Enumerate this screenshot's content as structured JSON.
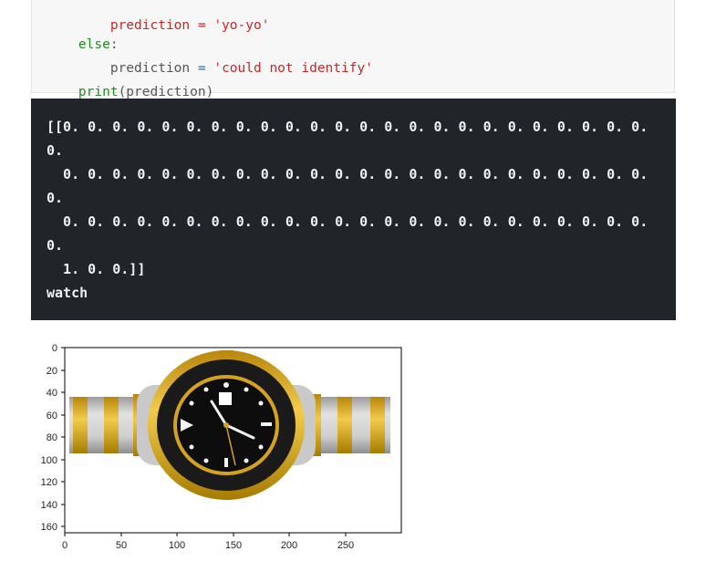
{
  "code": {
    "line1_partial": "    prediction = 'yo-yo'",
    "else_kw": "else",
    "else_colon": ":",
    "pred_indent": "    prediction ",
    "pred_eq": "=",
    "pred_str": "'could not identify'",
    "print_fn": "print",
    "print_args": "(prediction)"
  },
  "output": {
    "lines": [
      "[[0. 0. 0. 0. 0. 0. 0. 0. 0. 0. 0. 0. 0. 0. 0. 0. 0. 0. 0. 0. 0. 0. 0. 0.",
      "0.",
      "  0. 0. 0. 0. 0. 0. 0. 0. 0. 0. 0. 0. 0. 0. 0. 0. 0. 0. 0. 0. 0. 0. 0. 0.",
      "0.",
      "  0. 0. 0. 0. 0. 0. 0. 0. 0. 0. 0. 0. 0. 0. 0. 0. 0. 0. 0. 0. 0. 0. 0. 0.",
      "0.",
      "  1. 0. 0.]]",
      "watch"
    ]
  },
  "plot": {
    "y_ticks": [
      "0",
      "20",
      "40",
      "60",
      "80",
      "100",
      "120",
      "140",
      "160"
    ],
    "x_ticks": [
      "0",
      "50",
      "100",
      "150",
      "200",
      "250"
    ],
    "image_subject": "watch-image",
    "colors": {
      "gold": "#d4a21f",
      "steel": "#b8b8b8",
      "dial": "#111111"
    }
  }
}
